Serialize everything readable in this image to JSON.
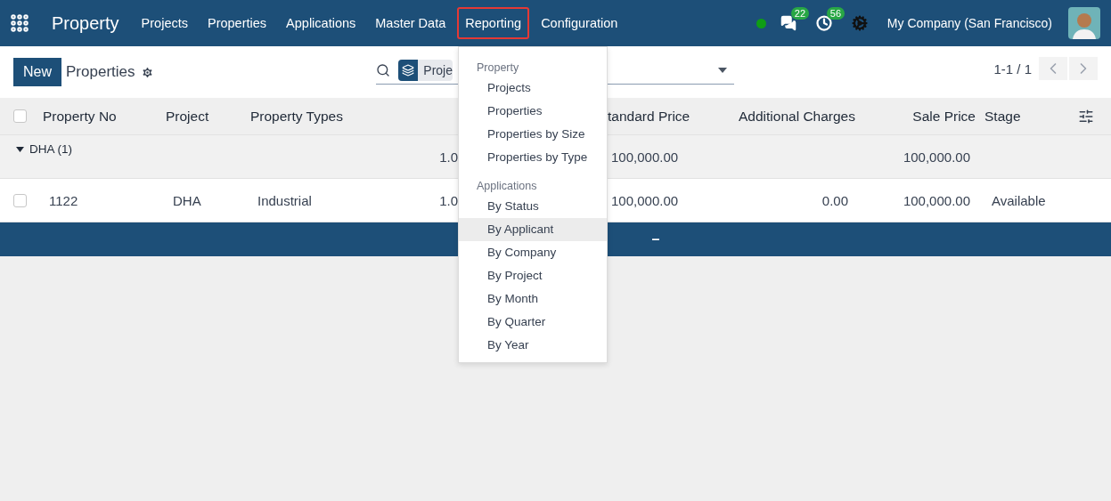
{
  "navbar": {
    "app_title": "Property",
    "menu": [
      {
        "label": "Projects",
        "open": false
      },
      {
        "label": "Properties",
        "open": false
      },
      {
        "label": "Applications",
        "open": false
      },
      {
        "label": "Master Data",
        "open": false
      },
      {
        "label": "Reporting",
        "open": true
      },
      {
        "label": "Configuration",
        "open": false
      }
    ],
    "online": true,
    "messages_count": "22",
    "activities_count": "56",
    "company": "My Company (San Francisco)"
  },
  "control_panel": {
    "new_button": "New",
    "title": "Properties",
    "search_facet": "Proje",
    "pager": "1-1 / 1"
  },
  "table": {
    "header_checked": false,
    "columns": {
      "property_no": "Property No",
      "project": "Project",
      "property_types": "Property Types",
      "standard_price": "tandard Price",
      "additional_charges": "Additional Charges",
      "sale_price": "Sale Price",
      "stage": "Stage"
    },
    "groups": [
      {
        "label": "DHA (1)",
        "expanded": true,
        "column_4": "1.0",
        "standard_price": "100,000.00",
        "sale_price": "100,000.00",
        "rows": [
          {
            "checked": false,
            "property_no": "1122",
            "project": "DHA",
            "property_types": "Industrial",
            "column_4": "1.0",
            "standard_price": "100,000.00",
            "additional_charges": "0.00",
            "sale_price": "100,000.00",
            "stage": "Available"
          }
        ]
      }
    ],
    "footer_mark": "–"
  },
  "reporting_menu": {
    "sections": [
      {
        "title": "Property",
        "items": [
          {
            "label": "Projects",
            "selected": false
          },
          {
            "label": "Properties",
            "selected": false
          },
          {
            "label": "Properties by Size",
            "selected": false
          },
          {
            "label": "Properties by Type",
            "selected": false
          }
        ]
      },
      {
        "title": "Applications",
        "items": [
          {
            "label": "By Status",
            "selected": false
          },
          {
            "label": "By Applicant",
            "selected": true
          },
          {
            "label": "By Company",
            "selected": false
          },
          {
            "label": "By Project",
            "selected": false
          },
          {
            "label": "By Month",
            "selected": false
          },
          {
            "label": "By Quarter",
            "selected": false
          },
          {
            "label": "By Year",
            "selected": false
          }
        ]
      }
    ]
  }
}
